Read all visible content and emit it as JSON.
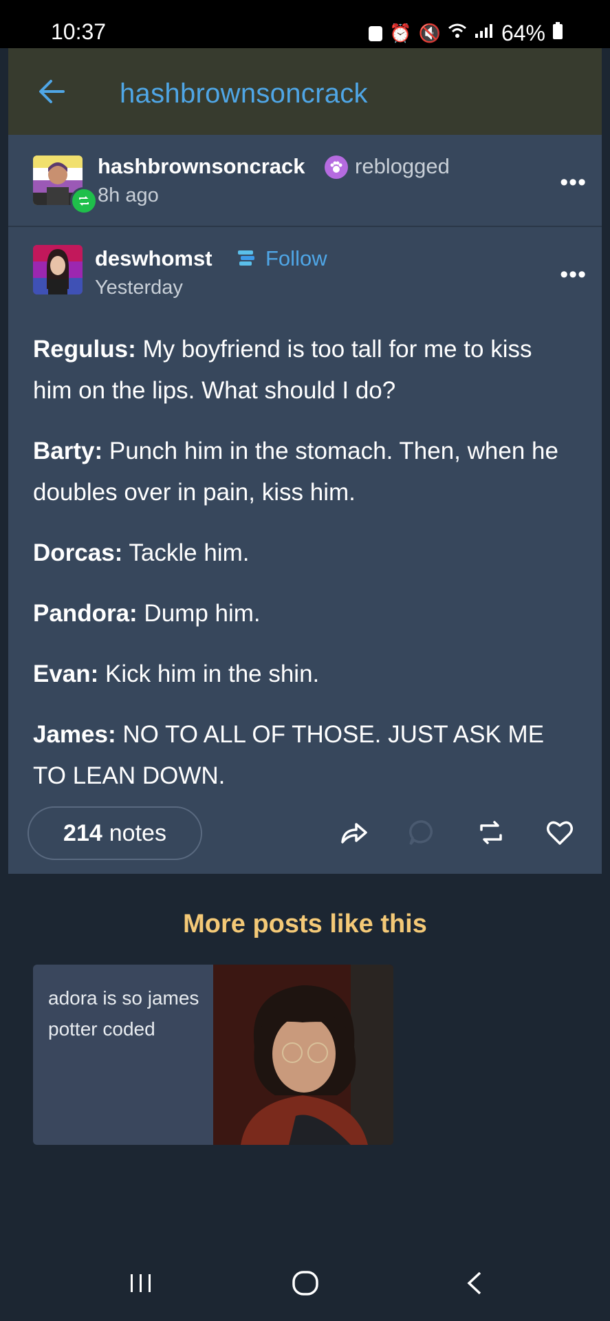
{
  "status_bar": {
    "time": "10:37",
    "battery": "64%"
  },
  "header": {
    "title": "hashbrownsoncrack",
    "back_icon": "arrow-left-icon"
  },
  "reblog": {
    "username": "hashbrownsoncrack",
    "action": "reblogged",
    "time": "8h ago"
  },
  "author": {
    "username": "deswhomst",
    "follow_label": "Follow",
    "time": "Yesterday"
  },
  "post": {
    "lines": [
      {
        "speaker": "Regulus:",
        "text": " My boyfriend is too tall for me to kiss him on the lips. What should I do?"
      },
      {
        "speaker": "Barty:",
        "text": " Punch him in the stomach. Then, when he doubles over in pain, kiss him."
      },
      {
        "speaker": "Dorcas:",
        "text": " Tackle him."
      },
      {
        "speaker": "Pandora:",
        "text": " Dump him."
      },
      {
        "speaker": "Evan:",
        "text": " Kick him in the shin."
      },
      {
        "speaker": "James:",
        "text": " NO TO ALL OF THOSE. JUST ASK ME TO LEAN DOWN."
      }
    ]
  },
  "notes": {
    "count": "214",
    "label": "notes"
  },
  "more_posts": {
    "title": "More posts like this",
    "cards": [
      {
        "text": "adora is so james potter coded"
      }
    ]
  },
  "colors": {
    "accent_blue": "#4fa6e6",
    "more_title": "#f4c977",
    "panel": "#37475c",
    "header": "#373b2e"
  }
}
